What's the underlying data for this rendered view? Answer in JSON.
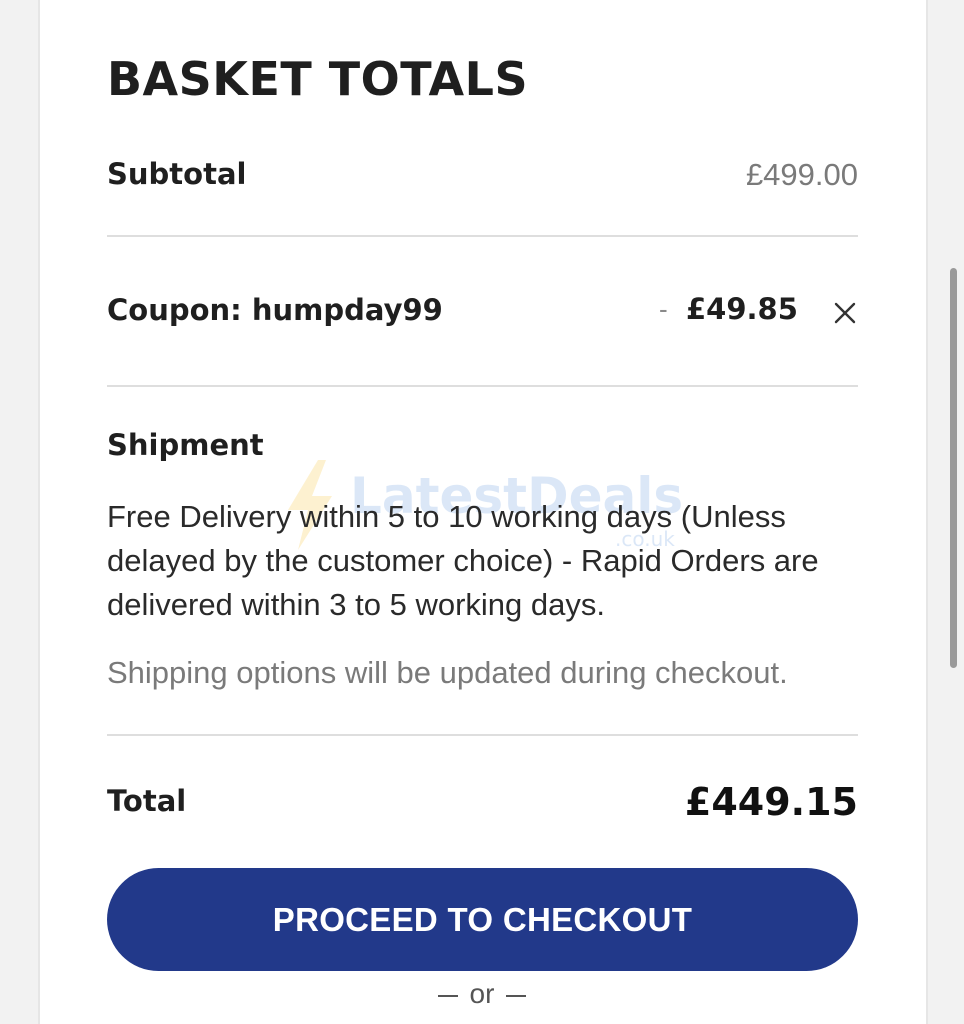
{
  "basket": {
    "title": "BASKET TOTALS",
    "subtotal_label": "Subtotal",
    "subtotal_value": "£499.00",
    "coupon_label": "Coupon: humpday99",
    "coupon_prefix": "-",
    "coupon_value": "£49.85",
    "shipment_label": "Shipment",
    "shipment_text": "Free Delivery within 5 to 10 working days (Unless delayed by the customer choice) - Rapid Orders are delivered within 3 to 5 working days.",
    "shipping_note": "Shipping options will be updated during checkout.",
    "total_label": "Total",
    "total_value": "£449.15",
    "checkout_label": "PROCEED TO CHECKOUT",
    "or_label": "or"
  },
  "watermark": {
    "text": "LatestDeals",
    "sub": ".co.uk"
  },
  "icons": {
    "remove_coupon": "close-icon",
    "watermark_logo": "lightning-bolt-icon"
  },
  "colors": {
    "primary_button": "#22398a",
    "text_dark": "#1f1f1f",
    "text_muted": "#7a7a7a",
    "divider": "#dedede"
  }
}
